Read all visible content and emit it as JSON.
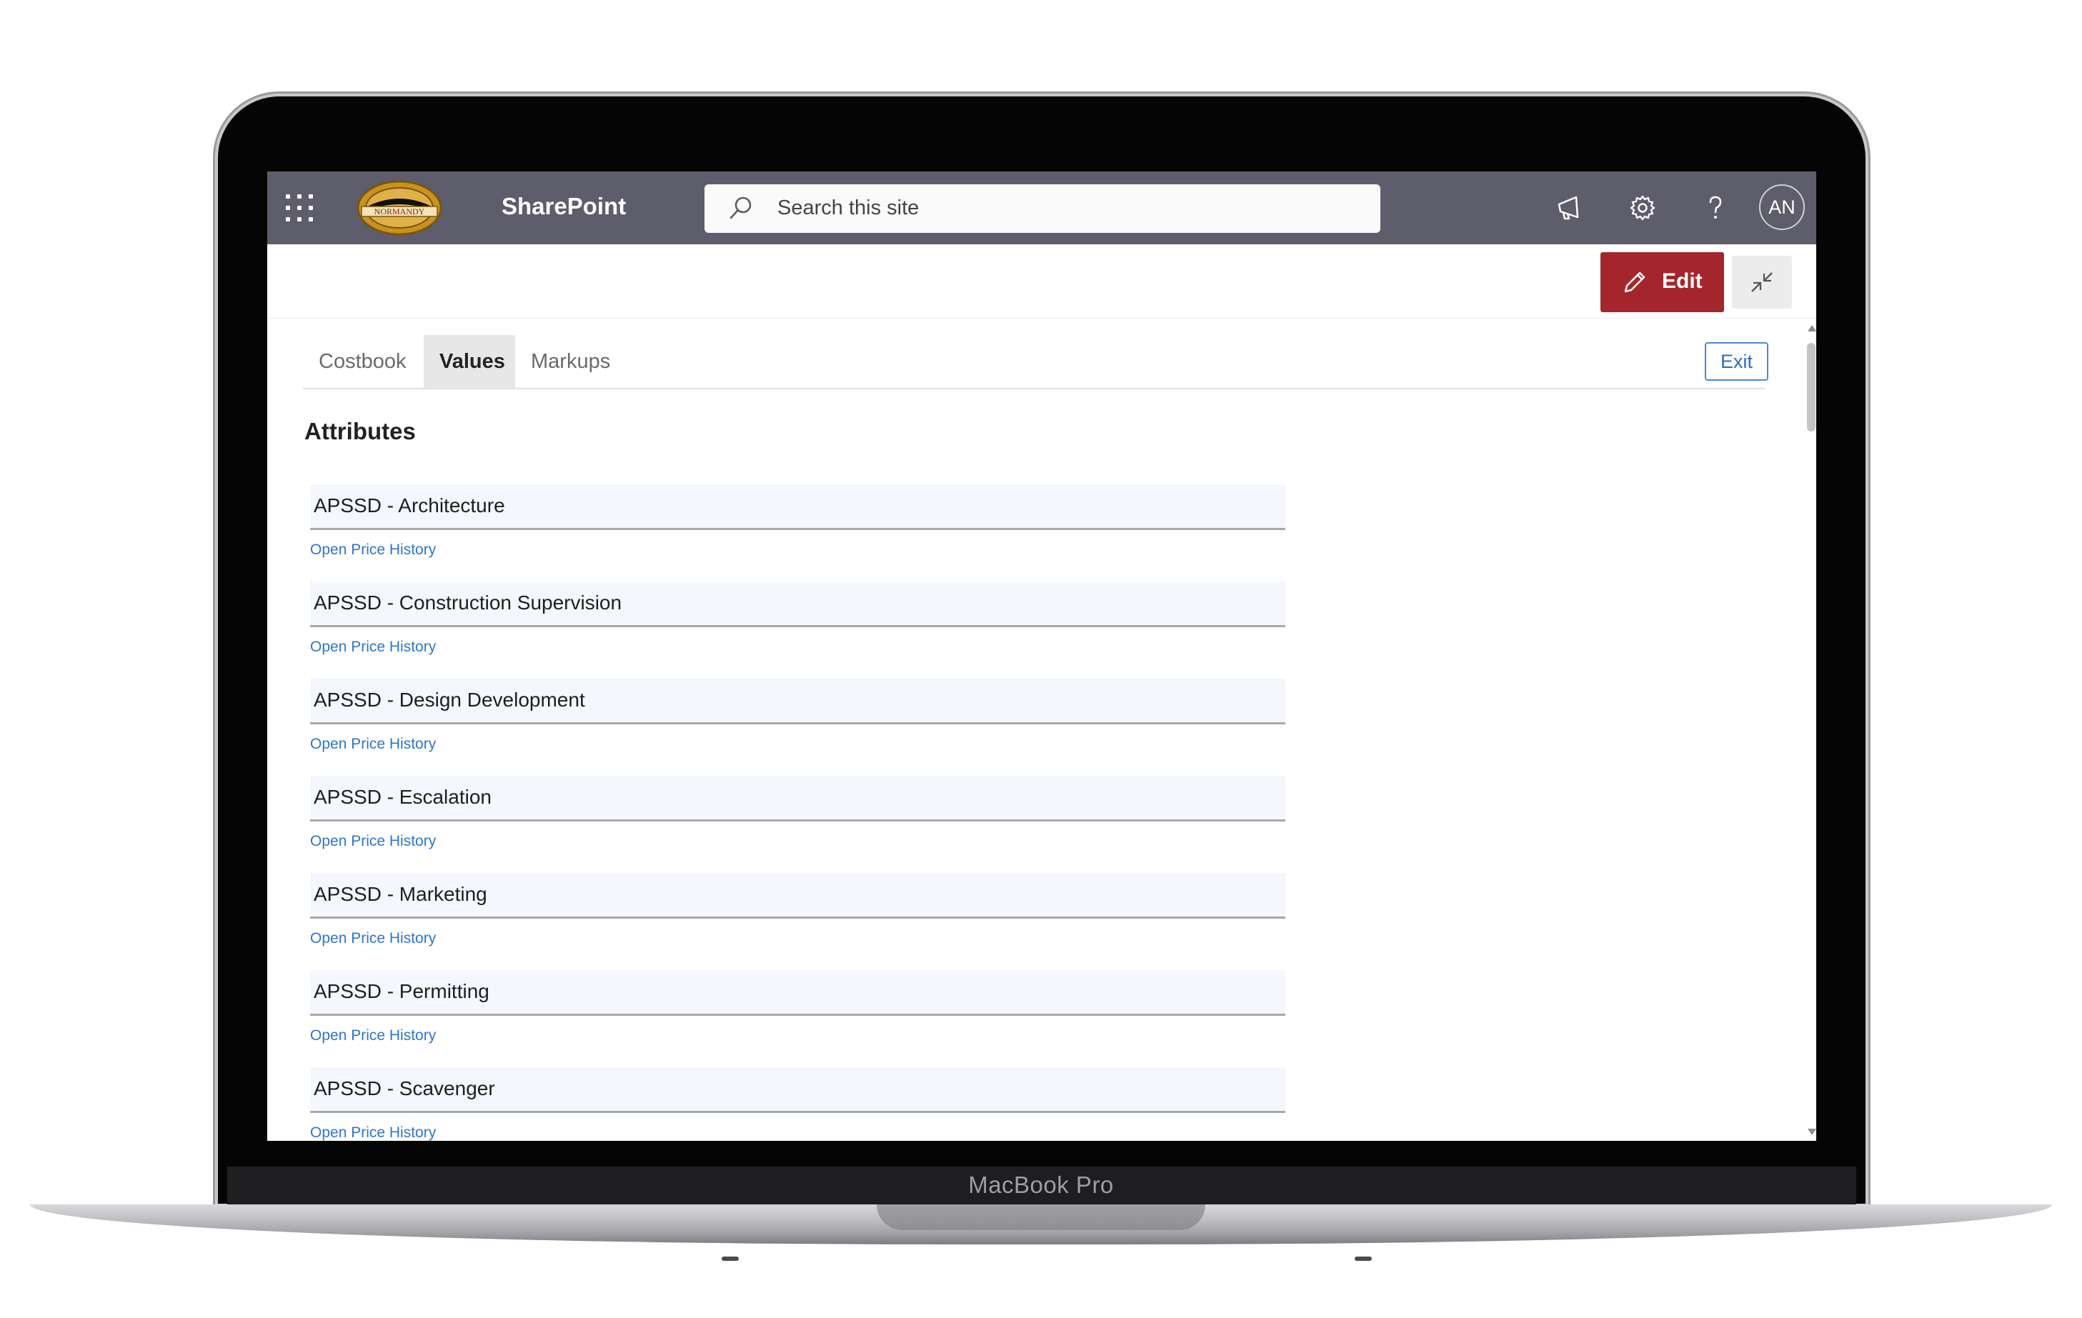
{
  "device": {
    "brand_label": "MacBook Pro"
  },
  "suitebar": {
    "app_title": "SharePoint",
    "logo_text": "NORMANDY",
    "search_placeholder": "Search this site",
    "avatar_initials": "AN"
  },
  "command_bar": {
    "edit_label": "Edit"
  },
  "tabs": [
    {
      "label": "Costbook",
      "active": false
    },
    {
      "label": "Values",
      "active": true
    },
    {
      "label": "Markups",
      "active": false
    }
  ],
  "exit_label": "Exit",
  "section_title": "Attributes",
  "attributes": [
    {
      "label": "APSSD - Architecture",
      "link": "Open Price History"
    },
    {
      "label": "APSSD - Construction Supervision",
      "link": "Open Price History"
    },
    {
      "label": "APSSD - Design Development",
      "link": "Open Price History"
    },
    {
      "label": "APSSD - Escalation",
      "link": "Open Price History"
    },
    {
      "label": "APSSD - Marketing",
      "link": "Open Price History"
    },
    {
      "label": "APSSD - Permitting",
      "link": "Open Price History"
    },
    {
      "label": "APSSD - Scavenger",
      "link": "Open Price History"
    }
  ],
  "colors": {
    "suitebar": "#5e5d6b",
    "edit_button": "#a4262c",
    "link": "#2e77c5",
    "field_background": "#f4f7fd"
  }
}
